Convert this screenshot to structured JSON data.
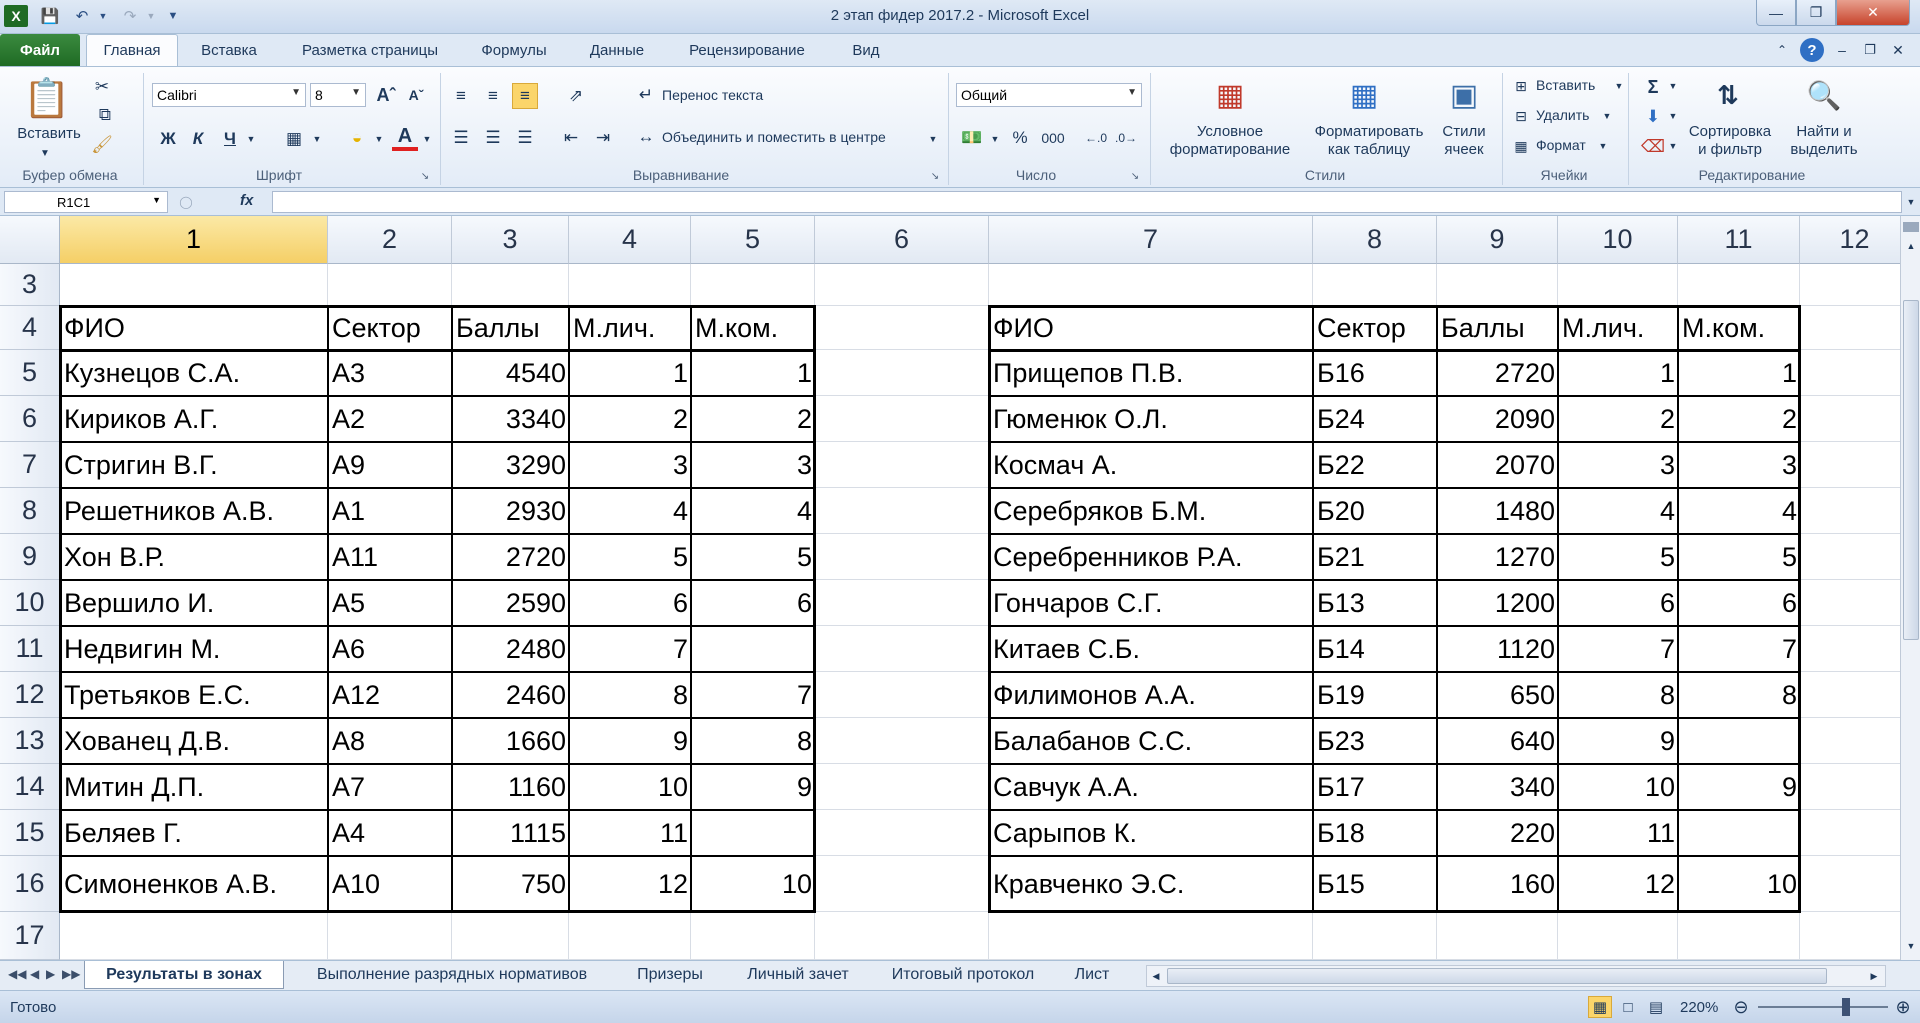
{
  "window": {
    "title": "2 этап фидер 2017.2 - Microsoft Excel",
    "qat_icons": [
      "excel-logo-icon",
      "save-icon",
      "undo-icon",
      "redo-icon",
      "customize-qat-icon"
    ]
  },
  "tabs": [
    "Файл",
    "Главная",
    "Вставка",
    "Разметка страницы",
    "Формулы",
    "Данные",
    "Рецензирование",
    "Вид"
  ],
  "ribbon": {
    "clipboard": {
      "paste": "Вставить",
      "label": "Буфер обмена"
    },
    "font": {
      "name": "Calibri",
      "size": "8",
      "bold": "Ж",
      "italic": "К",
      "underline": "Ч",
      "label": "Шрифт"
    },
    "alignment": {
      "wrap": "Перенос текста",
      "merge": "Объединить и поместить в центре",
      "label": "Выравнивание"
    },
    "number": {
      "format": "Общий",
      "percent": "%",
      "thousands": "000",
      "label": "Число"
    },
    "styles": {
      "conditional": "Условное форматирование",
      "as_table": "Форматировать как таблицу",
      "cell_styles": "Стили ячеек",
      "label": "Стили"
    },
    "cells": {
      "insert": "Вставить",
      "delete": "Удалить",
      "format": "Формат",
      "label": "Ячейки"
    },
    "editing": {
      "sort": "Сортировка и фильтр",
      "find": "Найти и выделить",
      "label": "Редактирование"
    }
  },
  "formula_bar": {
    "name_box": "R1C1",
    "fx": "fx",
    "value": ""
  },
  "columns": [
    "1",
    "2",
    "3",
    "4",
    "5",
    "6",
    "7",
    "8",
    "9",
    "10",
    "11",
    "12"
  ],
  "rows": [
    "3",
    "4",
    "5",
    "6",
    "7",
    "8",
    "9",
    "10",
    "11",
    "12",
    "13",
    "14",
    "15",
    "16",
    "17"
  ],
  "table_left": {
    "headers": [
      "ФИО",
      "Сектор",
      "Баллы",
      "М.лич.",
      "М.ком."
    ],
    "rows": [
      [
        "Кузнецов С.А.",
        "А3",
        "4540",
        "1",
        "1"
      ],
      [
        "Кириков А.Г.",
        "А2",
        "3340",
        "2",
        "2"
      ],
      [
        "Стригин В.Г.",
        "А9",
        "3290",
        "3",
        "3"
      ],
      [
        "Решетников А.В.",
        "А1",
        "2930",
        "4",
        "4"
      ],
      [
        "Хон В.Р.",
        "А11",
        "2720",
        "5",
        "5"
      ],
      [
        "Вершило И.",
        "А5",
        "2590",
        "6",
        "6"
      ],
      [
        "Недвигин М.",
        "А6",
        "2480",
        "7",
        ""
      ],
      [
        "Третьяков Е.С.",
        "А12",
        "2460",
        "8",
        "7"
      ],
      [
        "Хованец Д.В.",
        "А8",
        "1660",
        "9",
        "8"
      ],
      [
        "Митин Д.П.",
        "А7",
        "1160",
        "10",
        "9"
      ],
      [
        "Беляев Г.",
        "А4",
        "1115",
        "11",
        ""
      ],
      [
        "Симоненков А.В.",
        "А10",
        "750",
        "12",
        "10"
      ]
    ]
  },
  "table_right": {
    "headers": [
      "ФИО",
      "Сектор",
      "Баллы",
      "М.лич.",
      "М.ком."
    ],
    "rows": [
      [
        "Прищепов П.В.",
        "Б16",
        "2720",
        "1",
        "1"
      ],
      [
        "Гюменюк О.Л.",
        "Б24",
        "2090",
        "2",
        "2"
      ],
      [
        "Космач А.",
        "Б22",
        "2070",
        "3",
        "3"
      ],
      [
        "Серебряков Б.М.",
        "Б20",
        "1480",
        "4",
        "4"
      ],
      [
        "Серебренников Р.А.",
        "Б21",
        "1270",
        "5",
        "5"
      ],
      [
        "Гончаров С.Г.",
        "Б13",
        "1200",
        "6",
        "6"
      ],
      [
        "Китаев С.Б.",
        "Б14",
        "1120",
        "7",
        "7"
      ],
      [
        "Филимонов А.А.",
        "Б19",
        "650",
        "8",
        "8"
      ],
      [
        "Балабанов С.С.",
        "Б23",
        "640",
        "9",
        ""
      ],
      [
        "Савчук А.А.",
        "Б17",
        "340",
        "10",
        "9"
      ],
      [
        "Сарыпов К.",
        "Б18",
        "220",
        "11",
        ""
      ],
      [
        "Кравченко Э.С.",
        "Б15",
        "160",
        "12",
        "10"
      ]
    ]
  },
  "sheets": [
    "Результаты в зонах",
    "Выполнение разрядных нормативов",
    "Призеры",
    "Личный зачет",
    "Итоговый протокол",
    "Лист"
  ],
  "status": {
    "ready": "Готово",
    "zoom": "220%"
  }
}
